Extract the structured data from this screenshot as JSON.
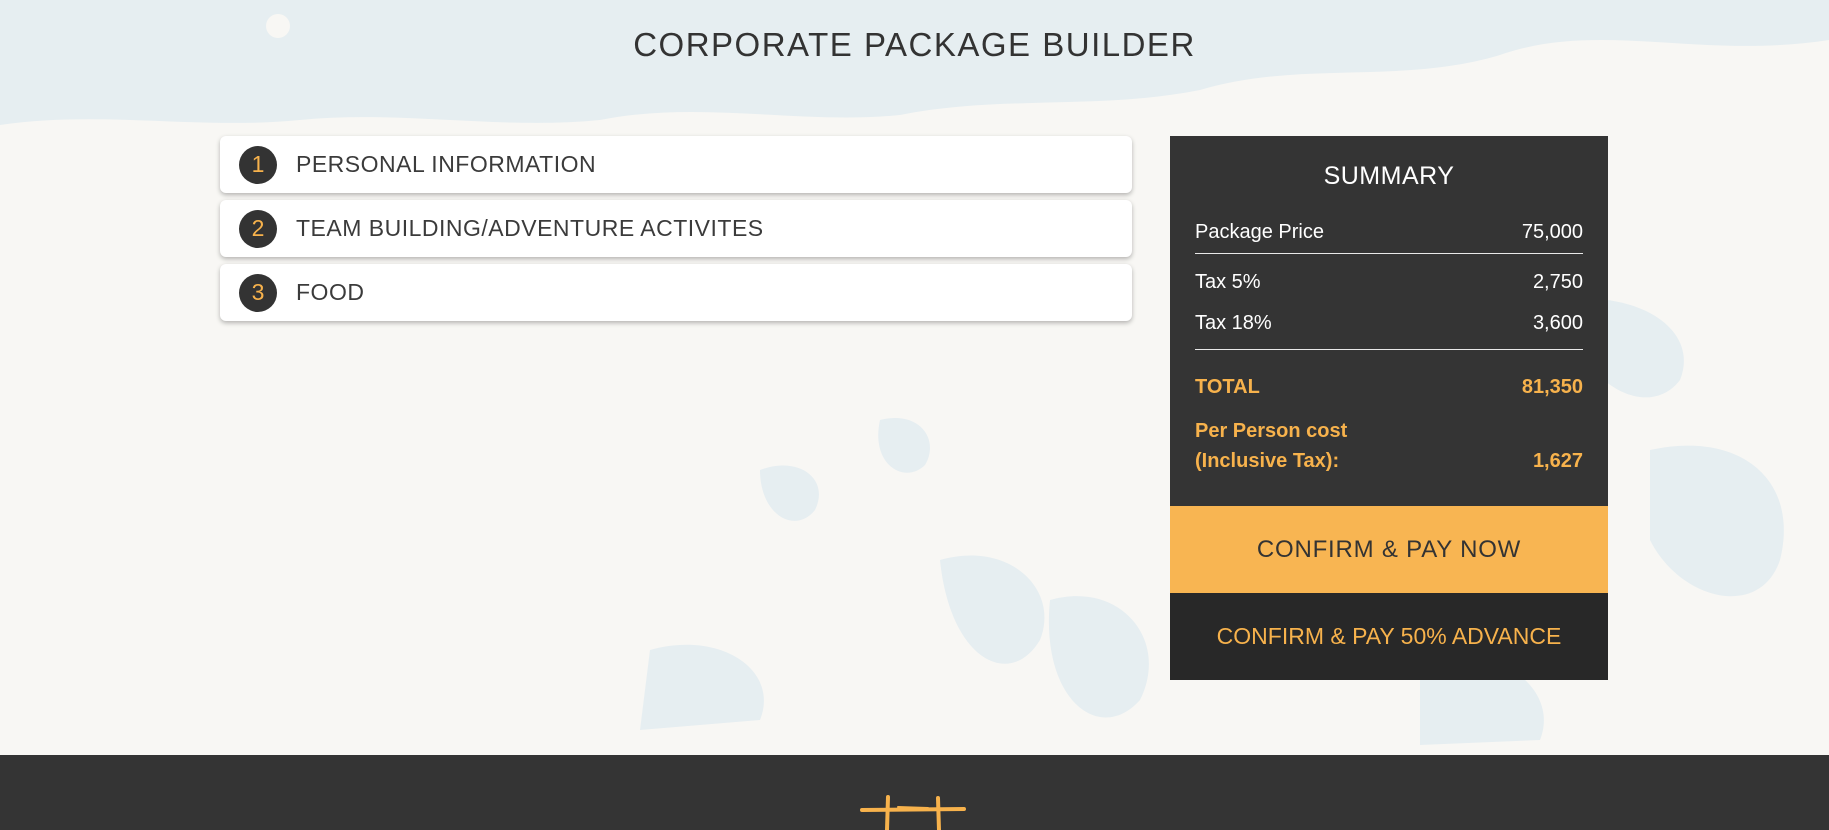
{
  "page": {
    "title": "CORPORATE PACKAGE BUILDER"
  },
  "steps": [
    {
      "number": "1",
      "label": "PERSONAL INFORMATION"
    },
    {
      "number": "2",
      "label": "TEAM BUILDING/ADVENTURE ACTIVITES"
    },
    {
      "number": "3",
      "label": "FOOD"
    }
  ],
  "summary": {
    "title": "SUMMARY",
    "package_price_label": "Package Price",
    "package_price_value": "75,000",
    "tax5_label": "Tax 5%",
    "tax5_value": "2,750",
    "tax18_label": "Tax 18%",
    "tax18_value": "3,600",
    "total_label": "TOTAL",
    "total_value": "81,350",
    "per_person_label": "Per Person cost (Inclusive Tax):",
    "per_person_value": "1,627"
  },
  "buttons": {
    "pay_now": "CONFIRM & PAY NOW",
    "pay_advance": "CONFIRM & PAY 50% ADVANCE"
  },
  "colors": {
    "accent": "#f7b24c",
    "dark": "#343434",
    "background": "#f8f7f4",
    "map": "#e6eef1"
  },
  "footer": {
    "logo_icon": "brand-logo-icon"
  }
}
